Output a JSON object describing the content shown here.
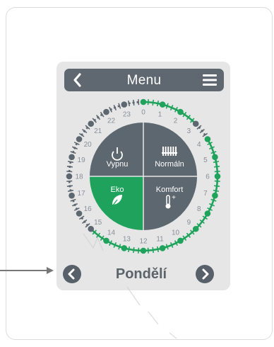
{
  "header": {
    "title": "Menu"
  },
  "modes": {
    "off": {
      "label": "Vypnu",
      "icon": "power-icon"
    },
    "normal": {
      "label": "Normáln",
      "icon": "radiator-icon"
    },
    "eco": {
      "label": "Eko",
      "icon": "leaf-icon"
    },
    "comfort": {
      "label": "Komfort",
      "icon": "thermometer-plus-icon"
    }
  },
  "active_mode": "eco",
  "hours": [
    "0",
    "1",
    "2",
    "3",
    "4",
    "5",
    "6",
    "7",
    "8",
    "9",
    "10",
    "11",
    "12",
    "13",
    "14",
    "15",
    "16",
    "17",
    "18",
    "19",
    "20",
    "21",
    "22",
    "23"
  ],
  "schedule": {
    "active_hours": [
      0,
      1,
      2,
      4,
      5,
      6,
      7,
      8,
      9,
      10,
      11,
      12,
      13,
      14
    ],
    "inactive_hours": [
      3,
      15,
      16,
      17,
      18,
      19,
      20,
      21,
      22,
      23
    ]
  },
  "day": {
    "label": "Pondělí"
  },
  "colors": {
    "accent_green": "#1fa35c",
    "segment_gray": "#5d6770",
    "active_dot": "#1fa35c",
    "inactive_dot": "#5d6770"
  },
  "icons": {
    "back": "chevron-left-icon",
    "menu": "hamburger-icon",
    "prev_day": "chevron-left-circle-icon",
    "next_day": "chevron-right-circle-icon"
  }
}
